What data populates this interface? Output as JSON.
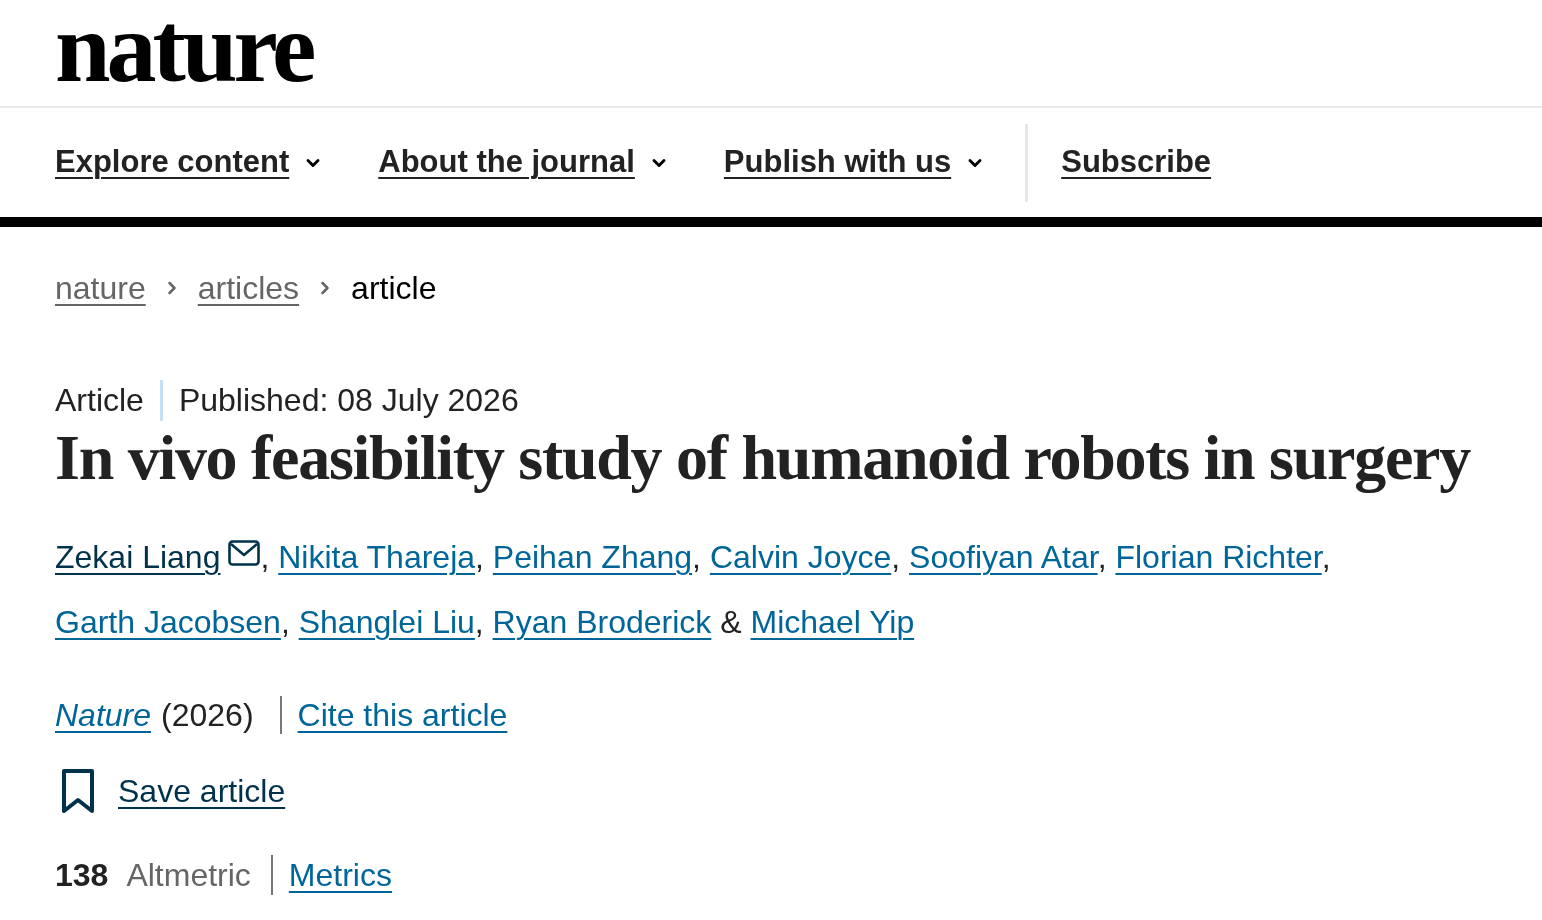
{
  "header": {
    "logo": "nature"
  },
  "nav": {
    "items": [
      {
        "label": "Explore content",
        "has_menu": true
      },
      {
        "label": "About the journal",
        "has_menu": true
      },
      {
        "label": "Publish with us",
        "has_menu": true
      },
      {
        "label": "Subscribe",
        "has_menu": false
      }
    ]
  },
  "breadcrumb": [
    {
      "label": "nature",
      "current": false
    },
    {
      "label": "articles",
      "current": false
    },
    {
      "label": "article",
      "current": true
    }
  ],
  "article": {
    "type": "Article",
    "published": "Published: 08 July 2026",
    "title": "In vivo feasibility study of humanoid robots in surgery",
    "authors": [
      {
        "name": "Zekai Liang",
        "corresponding": true,
        "separator": {
          "kind": "comma",
          "text": ","
        }
      },
      {
        "name": "Nikita Thareja",
        "corresponding": false,
        "separator": {
          "kind": "comma",
          "text": ","
        }
      },
      {
        "name": "Peihan Zhang",
        "corresponding": false,
        "separator": {
          "kind": "comma",
          "text": ","
        }
      },
      {
        "name": "Calvin Joyce",
        "corresponding": false,
        "separator": {
          "kind": "comma",
          "text": ","
        }
      },
      {
        "name": "Soofiyan Atar",
        "corresponding": false,
        "separator": {
          "kind": "comma",
          "text": ","
        }
      },
      {
        "name": "Florian Richter",
        "corresponding": false,
        "separator": {
          "kind": "comma",
          "text": ","
        }
      },
      {
        "name": "Garth Jacobsen",
        "corresponding": false,
        "separator": {
          "kind": "comma",
          "text": ","
        }
      },
      {
        "name": "Shanglei Liu",
        "corresponding": false,
        "separator": {
          "kind": "comma",
          "text": ","
        }
      },
      {
        "name": "Ryan Broderick",
        "corresponding": false,
        "separator": {
          "kind": "conjunction",
          "text": "&"
        }
      },
      {
        "name": "Michael Yip",
        "corresponding": false
      }
    ],
    "journal": "Nature",
    "year": "(2026)",
    "cite_link": "Cite this article",
    "save_link": "Save article",
    "metrics": {
      "score": "138",
      "label": "Altmetric",
      "link": "Metrics"
    }
  }
}
